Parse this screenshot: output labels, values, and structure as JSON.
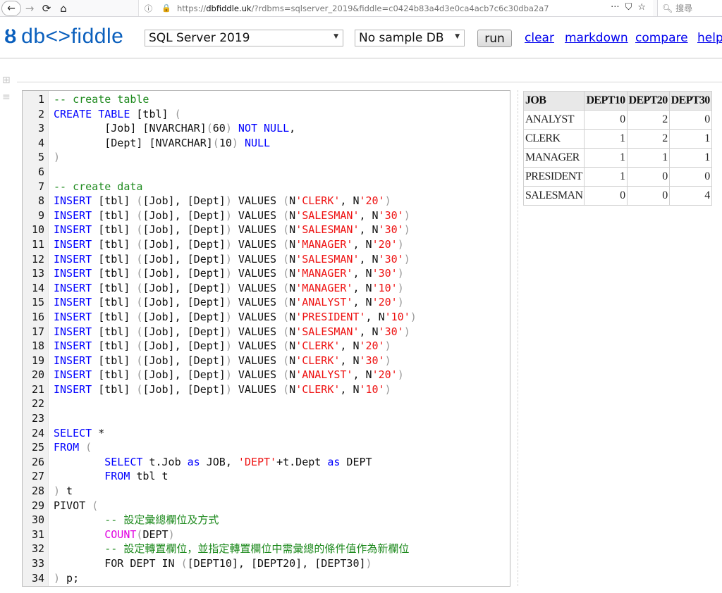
{
  "browser": {
    "back_icon": "arrow-left-icon",
    "forward_icon": "arrow-right-icon",
    "url_scheme": "https://",
    "url_host": "dbfiddle.uk",
    "url_path": "/?rdbms=sqlserver_2019&fiddle=c0424b83a4d3e0ca4acb7c6c30dba2a7",
    "search_placeholder": "搜尋"
  },
  "header": {
    "logo_text": "db<>fiddle",
    "rdbms_selected": "SQL Server 2019",
    "sample_db_selected": "No sample DB",
    "run_label": "run",
    "links": [
      "clear",
      "markdown",
      "compare",
      "help"
    ],
    "accent_color": "#0a5fbd",
    "link_color": "#0000ee"
  },
  "editor": {
    "lines": [
      {
        "n": "1",
        "segs": [
          [
            "cm",
            "-- create table"
          ]
        ]
      },
      {
        "n": "2",
        "segs": [
          [
            "kw",
            "CREATE TABLE"
          ],
          [
            "",
            " [tbl] "
          ],
          [
            "pn",
            "("
          ]
        ]
      },
      {
        "n": "3",
        "segs": [
          [
            "",
            "        [Job] [NVARCHAR]"
          ],
          [
            "pn",
            "("
          ],
          [
            "",
            "60"
          ],
          [
            "pn",
            ")"
          ],
          [
            "",
            " "
          ],
          [
            "kw",
            "NOT NULL"
          ],
          [
            "",
            ","
          ]
        ]
      },
      {
        "n": "4",
        "segs": [
          [
            "",
            "        [Dept] [NVARCHAR]"
          ],
          [
            "pn",
            "("
          ],
          [
            "",
            "10"
          ],
          [
            "pn",
            ")"
          ],
          [
            "",
            " "
          ],
          [
            "kw",
            "NULL"
          ]
        ]
      },
      {
        "n": "5",
        "segs": [
          [
            "pn",
            ")"
          ]
        ]
      },
      {
        "n": "6",
        "segs": []
      },
      {
        "n": "7",
        "segs": [
          [
            "cm",
            "-- create data"
          ]
        ]
      },
      {
        "n": "8",
        "segs": [
          [
            "kw",
            "INSERT"
          ],
          [
            "",
            " [tbl] "
          ],
          [
            "pn",
            "("
          ],
          [
            "",
            "[Job], [Dept]"
          ],
          [
            "pn",
            ")"
          ],
          [
            "",
            " VALUES "
          ],
          [
            "pn",
            "("
          ],
          [
            "",
            "N"
          ],
          [
            "st",
            "'CLERK'"
          ],
          [
            "",
            ", N"
          ],
          [
            "st",
            "'20'"
          ],
          [
            "pn",
            ")"
          ]
        ]
      },
      {
        "n": "9",
        "segs": [
          [
            "kw",
            "INSERT"
          ],
          [
            "",
            " [tbl] "
          ],
          [
            "pn",
            "("
          ],
          [
            "",
            "[Job], [Dept]"
          ],
          [
            "pn",
            ")"
          ],
          [
            "",
            " VALUES "
          ],
          [
            "pn",
            "("
          ],
          [
            "",
            "N"
          ],
          [
            "st",
            "'SALESMAN'"
          ],
          [
            "",
            ", N"
          ],
          [
            "st",
            "'30'"
          ],
          [
            "pn",
            ")"
          ]
        ]
      },
      {
        "n": "10",
        "segs": [
          [
            "kw",
            "INSERT"
          ],
          [
            "",
            " [tbl] "
          ],
          [
            "pn",
            "("
          ],
          [
            "",
            "[Job], [Dept]"
          ],
          [
            "pn",
            ")"
          ],
          [
            "",
            " VALUES "
          ],
          [
            "pn",
            "("
          ],
          [
            "",
            "N"
          ],
          [
            "st",
            "'SALESMAN'"
          ],
          [
            "",
            ", N"
          ],
          [
            "st",
            "'30'"
          ],
          [
            "pn",
            ")"
          ]
        ]
      },
      {
        "n": "11",
        "segs": [
          [
            "kw",
            "INSERT"
          ],
          [
            "",
            " [tbl] "
          ],
          [
            "pn",
            "("
          ],
          [
            "",
            "[Job], [Dept]"
          ],
          [
            "pn",
            ")"
          ],
          [
            "",
            " VALUES "
          ],
          [
            "pn",
            "("
          ],
          [
            "",
            "N"
          ],
          [
            "st",
            "'MANAGER'"
          ],
          [
            "",
            ", N"
          ],
          [
            "st",
            "'20'"
          ],
          [
            "pn",
            ")"
          ]
        ]
      },
      {
        "n": "12",
        "segs": [
          [
            "kw",
            "INSERT"
          ],
          [
            "",
            " [tbl] "
          ],
          [
            "pn",
            "("
          ],
          [
            "",
            "[Job], [Dept]"
          ],
          [
            "pn",
            ")"
          ],
          [
            "",
            " VALUES "
          ],
          [
            "pn",
            "("
          ],
          [
            "",
            "N"
          ],
          [
            "st",
            "'SALESMAN'"
          ],
          [
            "",
            ", N"
          ],
          [
            "st",
            "'30'"
          ],
          [
            "pn",
            ")"
          ]
        ]
      },
      {
        "n": "13",
        "segs": [
          [
            "kw",
            "INSERT"
          ],
          [
            "",
            " [tbl] "
          ],
          [
            "pn",
            "("
          ],
          [
            "",
            "[Job], [Dept]"
          ],
          [
            "pn",
            ")"
          ],
          [
            "",
            " VALUES "
          ],
          [
            "pn",
            "("
          ],
          [
            "",
            "N"
          ],
          [
            "st",
            "'MANAGER'"
          ],
          [
            "",
            ", N"
          ],
          [
            "st",
            "'30'"
          ],
          [
            "pn",
            ")"
          ]
        ]
      },
      {
        "n": "14",
        "segs": [
          [
            "kw",
            "INSERT"
          ],
          [
            "",
            " [tbl] "
          ],
          [
            "pn",
            "("
          ],
          [
            "",
            "[Job], [Dept]"
          ],
          [
            "pn",
            ")"
          ],
          [
            "",
            " VALUES "
          ],
          [
            "pn",
            "("
          ],
          [
            "",
            "N"
          ],
          [
            "st",
            "'MANAGER'"
          ],
          [
            "",
            ", N"
          ],
          [
            "st",
            "'10'"
          ],
          [
            "pn",
            ")"
          ]
        ]
      },
      {
        "n": "15",
        "segs": [
          [
            "kw",
            "INSERT"
          ],
          [
            "",
            " [tbl] "
          ],
          [
            "pn",
            "("
          ],
          [
            "",
            "[Job], [Dept]"
          ],
          [
            "pn",
            ")"
          ],
          [
            "",
            " VALUES "
          ],
          [
            "pn",
            "("
          ],
          [
            "",
            "N"
          ],
          [
            "st",
            "'ANALYST'"
          ],
          [
            "",
            ", N"
          ],
          [
            "st",
            "'20'"
          ],
          [
            "pn",
            ")"
          ]
        ]
      },
      {
        "n": "16",
        "segs": [
          [
            "kw",
            "INSERT"
          ],
          [
            "",
            " [tbl] "
          ],
          [
            "pn",
            "("
          ],
          [
            "",
            "[Job], [Dept]"
          ],
          [
            "pn",
            ")"
          ],
          [
            "",
            " VALUES "
          ],
          [
            "pn",
            "("
          ],
          [
            "",
            "N"
          ],
          [
            "st",
            "'PRESIDENT'"
          ],
          [
            "",
            ", N"
          ],
          [
            "st",
            "'10'"
          ],
          [
            "pn",
            ")"
          ]
        ]
      },
      {
        "n": "17",
        "segs": [
          [
            "kw",
            "INSERT"
          ],
          [
            "",
            " [tbl] "
          ],
          [
            "pn",
            "("
          ],
          [
            "",
            "[Job], [Dept]"
          ],
          [
            "pn",
            ")"
          ],
          [
            "",
            " VALUES "
          ],
          [
            "pn",
            "("
          ],
          [
            "",
            "N"
          ],
          [
            "st",
            "'SALESMAN'"
          ],
          [
            "",
            ", N"
          ],
          [
            "st",
            "'30'"
          ],
          [
            "pn",
            ")"
          ]
        ]
      },
      {
        "n": "18",
        "segs": [
          [
            "kw",
            "INSERT"
          ],
          [
            "",
            " [tbl] "
          ],
          [
            "pn",
            "("
          ],
          [
            "",
            "[Job], [Dept]"
          ],
          [
            "pn",
            ")"
          ],
          [
            "",
            " VALUES "
          ],
          [
            "pn",
            "("
          ],
          [
            "",
            "N"
          ],
          [
            "st",
            "'CLERK'"
          ],
          [
            "",
            ", N"
          ],
          [
            "st",
            "'20'"
          ],
          [
            "pn",
            ")"
          ]
        ]
      },
      {
        "n": "19",
        "segs": [
          [
            "kw",
            "INSERT"
          ],
          [
            "",
            " [tbl] "
          ],
          [
            "pn",
            "("
          ],
          [
            "",
            "[Job], [Dept]"
          ],
          [
            "pn",
            ")"
          ],
          [
            "",
            " VALUES "
          ],
          [
            "pn",
            "("
          ],
          [
            "",
            "N"
          ],
          [
            "st",
            "'CLERK'"
          ],
          [
            "",
            ", N"
          ],
          [
            "st",
            "'30'"
          ],
          [
            "pn",
            ")"
          ]
        ]
      },
      {
        "n": "20",
        "segs": [
          [
            "kw",
            "INSERT"
          ],
          [
            "",
            " [tbl] "
          ],
          [
            "pn",
            "("
          ],
          [
            "",
            "[Job], [Dept]"
          ],
          [
            "pn",
            ")"
          ],
          [
            "",
            " VALUES "
          ],
          [
            "pn",
            "("
          ],
          [
            "",
            "N"
          ],
          [
            "st",
            "'ANALYST'"
          ],
          [
            "",
            ", N"
          ],
          [
            "st",
            "'20'"
          ],
          [
            "pn",
            ")"
          ]
        ]
      },
      {
        "n": "21",
        "segs": [
          [
            "kw",
            "INSERT"
          ],
          [
            "",
            " [tbl] "
          ],
          [
            "pn",
            "("
          ],
          [
            "",
            "[Job], [Dept]"
          ],
          [
            "pn",
            ")"
          ],
          [
            "",
            " VALUES "
          ],
          [
            "pn",
            "("
          ],
          [
            "",
            "N"
          ],
          [
            "st",
            "'CLERK'"
          ],
          [
            "",
            ", N"
          ],
          [
            "st",
            "'10'"
          ],
          [
            "pn",
            ")"
          ]
        ]
      },
      {
        "n": "22",
        "segs": []
      },
      {
        "n": "23",
        "segs": []
      },
      {
        "n": "24",
        "segs": [
          [
            "kw",
            "SELECT"
          ],
          [
            "",
            " *"
          ]
        ]
      },
      {
        "n": "25",
        "segs": [
          [
            "kw",
            "FROM"
          ],
          [
            "",
            " "
          ],
          [
            "pn",
            "("
          ]
        ]
      },
      {
        "n": "26",
        "segs": [
          [
            "",
            "        "
          ],
          [
            "kw",
            "SELECT"
          ],
          [
            "",
            " t.Job "
          ],
          [
            "kw",
            "as"
          ],
          [
            "",
            " JOB, "
          ],
          [
            "st",
            "'DEPT'"
          ],
          [
            "",
            "+t.Dept "
          ],
          [
            "kw",
            "as"
          ],
          [
            "",
            " DEPT"
          ]
        ]
      },
      {
        "n": "27",
        "segs": [
          [
            "",
            "        "
          ],
          [
            "kw",
            "FROM"
          ],
          [
            "",
            " tbl t"
          ]
        ]
      },
      {
        "n": "28",
        "segs": [
          [
            "pn",
            ")"
          ],
          [
            "",
            " t"
          ]
        ]
      },
      {
        "n": "29",
        "segs": [
          [
            "",
            "PIVOT "
          ],
          [
            "pn",
            "("
          ]
        ]
      },
      {
        "n": "30",
        "segs": [
          [
            "",
            "        "
          ],
          [
            "cm",
            "-- 設定彙總欄位及方式"
          ]
        ]
      },
      {
        "n": "31",
        "segs": [
          [
            "",
            "        "
          ],
          [
            "fn",
            "COUNT"
          ],
          [
            "pn",
            "("
          ],
          [
            "",
            "DEPT"
          ],
          [
            "pn",
            ")"
          ]
        ]
      },
      {
        "n": "32",
        "segs": [
          [
            "",
            "        "
          ],
          [
            "cm",
            "-- 設定轉置欄位，並指定轉置欄位中需彙總的條件值作為新欄位"
          ]
        ]
      },
      {
        "n": "33",
        "segs": [
          [
            "",
            "        FOR DEPT IN "
          ],
          [
            "pn",
            "("
          ],
          [
            "",
            "[DEPT10], [DEPT20], [DEPT30]"
          ],
          [
            "pn",
            ")"
          ]
        ]
      },
      {
        "n": "34",
        "segs": [
          [
            "pn",
            ")"
          ],
          [
            "",
            " p;"
          ]
        ]
      }
    ]
  },
  "result": {
    "columns": [
      "JOB",
      "DEPT10",
      "DEPT20",
      "DEPT30"
    ],
    "rows": [
      [
        "ANALYST",
        "0",
        "2",
        "0"
      ],
      [
        "CLERK",
        "1",
        "2",
        "1"
      ],
      [
        "MANAGER",
        "1",
        "1",
        "1"
      ],
      [
        "PRESIDENT",
        "1",
        "0",
        "0"
      ],
      [
        "SALESMAN",
        "0",
        "0",
        "4"
      ]
    ]
  },
  "margin_controls": [
    "add-box-icon",
    "hamburger-menu-icon"
  ]
}
